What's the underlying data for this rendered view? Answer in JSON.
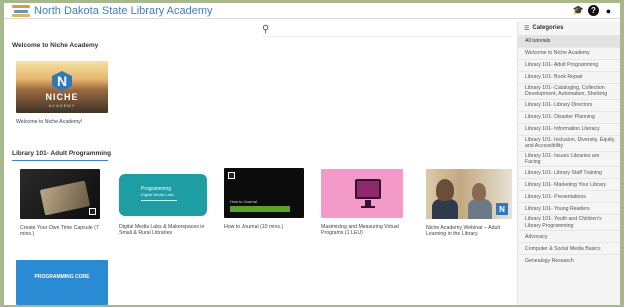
{
  "header": {
    "site_title": "North Dakota State Library Academy",
    "icons": [
      "graduation-cap-icon",
      "help-icon",
      "user-icon"
    ]
  },
  "search": {
    "placeholder": ""
  },
  "sections": [
    {
      "title": "Welcome to Niche Academy",
      "cards": [
        {
          "caption": "Welcome to Niche Academy!",
          "thumb_text": "NICHE",
          "thumb_sub": "ACADEMY"
        }
      ]
    },
    {
      "title": "Library 101- Adult Programming",
      "cards": [
        {
          "caption": "Create Your Own Time Capsule (7 mins.)"
        },
        {
          "caption": "Digital Media Labs & Makerspaces in Small & Rural Libraries",
          "thumb_line1": "Programming",
          "thumb_line2": "Digital Media Labs"
        },
        {
          "caption": "How to Journal (10 mins.)",
          "thumb_text": "How to Journal"
        },
        {
          "caption": "Maximizing and Measuring Virtual Programs (1 LEU)"
        },
        {
          "caption": "Niche Academy Webinar – Adult Learning in the Library",
          "badge": "N"
        },
        {
          "caption": "",
          "thumb_text": "PROGRAMMING CORE"
        }
      ]
    }
  ],
  "sidebar": {
    "title": "Categories",
    "items": [
      {
        "label": "All tutorials",
        "active": true
      },
      {
        "label": "Welcome to Niche Academy"
      },
      {
        "label": "Library 101- Adult Programming"
      },
      {
        "label": "Library 101- Book Repair"
      },
      {
        "label": "Library 101- Cataloging, Collection Development, Automation, Shelving"
      },
      {
        "label": "Library 101- Library Directors"
      },
      {
        "label": "Library 101- Disaster Planning"
      },
      {
        "label": "Library 101- Information Literacy"
      },
      {
        "label": "Library 101- Inclusion, Diversity, Equity, and Accessibility"
      },
      {
        "label": "Library 101- Issues Libraries are Facing"
      },
      {
        "label": "Library 101- Library Staff Training"
      },
      {
        "label": "Library 101- Marketing Your Library"
      },
      {
        "label": "Library 101- Presentations"
      },
      {
        "label": "Library 101- Young Readers"
      },
      {
        "label": "Library 101- Youth and Children's Library Programming"
      },
      {
        "label": "Advocacy"
      },
      {
        "label": "Computer & Social Media Basics"
      },
      {
        "label": "Genealogy Research"
      }
    ]
  },
  "colors": {
    "accent": "#3f7fc3",
    "frame": "#a7b88c"
  }
}
